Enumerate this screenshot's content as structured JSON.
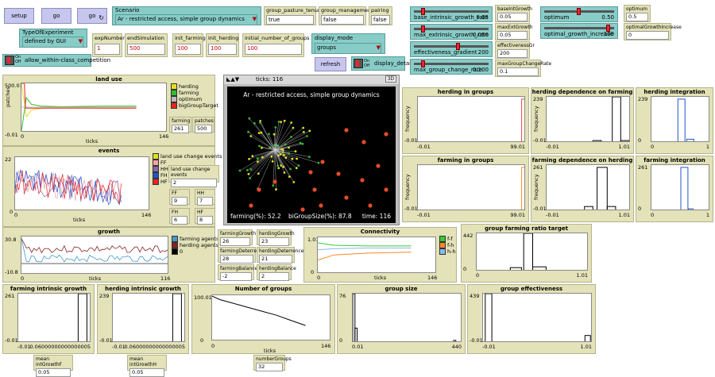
{
  "controls": {
    "setup_label": "setup",
    "go_label": "go",
    "go_forever_label": "go",
    "refresh_label": "refresh",
    "on_label": "On",
    "off_label": "Off"
  },
  "scenario": {
    "label": "Scenario",
    "value": "Ar - restricted access, simple group dynamics"
  },
  "group_pasture_tenure": {
    "label": "group_pasture_tenure",
    "value": "true"
  },
  "group_management": {
    "label": "group_management",
    "value": "false"
  },
  "pairing": {
    "label": "pairing",
    "value": "false"
  },
  "type_of_experiment": {
    "label": "TypeOfExperiment",
    "value": "defined by GUI"
  },
  "exp_number": {
    "label": "expNumber",
    "value": "1"
  },
  "end_simulation": {
    "label": "endSimulation",
    "value": "500"
  },
  "init_farming": {
    "label": "init_farming",
    "value": "100"
  },
  "init_herding": {
    "label": "init_herding",
    "value": "100"
  },
  "initial_number_of_groups": {
    "label": "initial_number_of_groups",
    "value": "100"
  },
  "display_mode": {
    "label": "display_mode",
    "value": "groups"
  },
  "display_details": {
    "label": "display_details"
  },
  "allow_within_class": {
    "label": "allow_within-class_competition"
  },
  "sliders": {
    "base_intrinsic": {
      "label": "base_intrinsic_growth_rate",
      "value": "0.05",
      "level": 0.1
    },
    "max_extrinsic": {
      "label": "max_extrinsic_growth_rate",
      "value": "0.050",
      "level": 0.1
    },
    "effectiveness": {
      "label": "effectiveness_gradient",
      "value": "200",
      "level": 0.6
    },
    "max_group_change": {
      "label": "max_group_change_rate",
      "value": "0.100",
      "level": 0.1
    },
    "optimum": {
      "label": "optimum",
      "value": "0.50",
      "level": 0.5
    },
    "optimal_growth": {
      "label": "optimal_growth_increase",
      "value": "100",
      "level": 0.95
    }
  },
  "monitors": {
    "base_int_growth": {
      "label": "baseIntGrowth",
      "value": "0.05"
    },
    "max_ext_growth": {
      "label": "maxExtGrowth",
      "value": "0.05"
    },
    "effectiveness_gr": {
      "label": "effectivenessGr",
      "value": "200"
    },
    "max_group_change_rate": {
      "label": "maxGroupChangeRate",
      "value": "0.1"
    },
    "optimum_m": {
      "label": "optimum",
      "value": "0.5"
    },
    "optimal_growth_increase": {
      "label": "optimalGrowthIncrease",
      "value": "0"
    },
    "farming": {
      "label": "farming",
      "value": "261"
    },
    "patches": {
      "label": "patches",
      "value": "500"
    },
    "land_use_change_events": {
      "label": "land use change events",
      "value": "2"
    },
    "ff": {
      "label": "FF",
      "value": "9"
    },
    "hh": {
      "label": "HH",
      "value": "7"
    },
    "fh": {
      "label": "FH",
      "value": "6"
    },
    "hf": {
      "label": "HF",
      "value": "8"
    },
    "farming_growth": {
      "label": "farmingGrowth",
      "value": "26"
    },
    "herding_growth": {
      "label": "herdingGrowth",
      "value": "23"
    },
    "farming_deterrence": {
      "label": "farmingDeterrence",
      "value": "28"
    },
    "herding_deterrence": {
      "label": "herdingDeterrence",
      "value": "21"
    },
    "farming_balance": {
      "label": "farmingBalance",
      "value": "-2"
    },
    "herding_balance": {
      "label": "herdingBalance",
      "value": "2"
    },
    "mean_int_growth_f": {
      "label": "mean intGrowthF",
      "value": "0.05"
    },
    "mean_int_growth_h": {
      "label": "mean intGrowthH",
      "value": "0.05"
    },
    "number_groups": {
      "label": "numberGroups",
      "value": "32"
    }
  },
  "view": {
    "ticks_label": "ticks: 116",
    "three_d": "3D",
    "title": "Ar - restricted access, simple group dynamics",
    "farming_pct": "farming(%): 52.2",
    "big_group_size": "biGroupSize(%): 87.8",
    "time": "time: 116"
  },
  "colors": {
    "herding": "#e0e020",
    "farming": "#33bb33",
    "optimum": "#bbbbbb",
    "big_group_target": "#ee2222",
    "ff": "#f0a0a8",
    "hh": "#8866aa",
    "fh": "#2255cc",
    "hf": "#ee2222",
    "farming_agents": "#4499cc",
    "herding_agents": "#882222",
    "zero": "#000000",
    "f_f": "#33cc33",
    "f_h": "#ff8822",
    "h_h": "#88bbee"
  },
  "chart_data": [
    {
      "name": "land use",
      "type": "line",
      "title": "land use",
      "ylabel": "patches",
      "xlabel": "ticks",
      "ylim": [
        -0.01,
        500.01
      ],
      "xlim": [
        0,
        146
      ],
      "y_top_label": "500.01",
      "y_bottom_label": "-0.01",
      "x_left_label": "0",
      "x_right_label": "146",
      "legend": [
        "herding",
        "farming",
        "optimum",
        "bigGroupTarget"
      ],
      "series": [
        {
          "name": "herding",
          "x": [
            0,
            5,
            10,
            20,
            40,
            80,
            116
          ],
          "y": [
            500,
            150,
            220,
            240,
            245,
            240,
            239
          ]
        },
        {
          "name": "farming",
          "x": [
            0,
            5,
            10,
            20,
            40,
            80,
            116
          ],
          "y": [
            0,
            350,
            280,
            260,
            255,
            260,
            261
          ]
        },
        {
          "name": "optimum",
          "x": [
            0,
            116
          ],
          "y": [
            250,
            250
          ]
        },
        {
          "name": "bigGroupTarget",
          "x": [
            0,
            3,
            4,
            116
          ],
          "y": [
            500,
            500,
            240,
            240
          ]
        }
      ]
    },
    {
      "name": "events",
      "type": "line",
      "title": "events",
      "xlabel": "ticks",
      "ylim": [
        0,
        22
      ],
      "xlim": [
        0,
        146
      ],
      "y_top_label": "22",
      "y_bottom_label": "0",
      "x_left_label": "0",
      "x_right_label": "146",
      "legend": [
        "land use change events",
        "FF",
        "HH",
        "FH",
        "HF"
      ]
    },
    {
      "name": "growth",
      "type": "line",
      "title": "growth",
      "xlabel": "ticks",
      "ylim": [
        -10.8,
        30.8
      ],
      "xlim": [
        0,
        116
      ],
      "y_top_label": "30.8",
      "y_bottom_label": "-10.8",
      "x_left_label": "0",
      "x_right_label": "116",
      "legend": [
        "farming agents",
        "herding agents",
        "0"
      ]
    },
    {
      "name": "Connectivity",
      "type": "line",
      "title": "Connectivity",
      "xlabel": "ticks",
      "ylim": [
        0,
        1.01
      ],
      "xlim": [
        0,
        146
      ],
      "y_top_label": "1.01",
      "y_bottom_label": "0",
      "x_left_label": "0",
      "x_right_label": "146",
      "legend": [
        "f-f",
        "f-h",
        "h-h"
      ],
      "series": [
        {
          "name": "f-f",
          "x": [
            0,
            20,
            60,
            116
          ],
          "y": [
            0.85,
            0.78,
            0.76,
            0.76
          ]
        },
        {
          "name": "f-h",
          "x": [
            0,
            20,
            60,
            116
          ],
          "y": [
            0.35,
            0.5,
            0.55,
            0.58
          ]
        },
        {
          "name": "h-h",
          "x": [
            0,
            20,
            60,
            116
          ],
          "y": [
            0.65,
            0.68,
            0.7,
            0.7
          ]
        }
      ]
    },
    {
      "name": "herding in groups",
      "type": "bar",
      "title": "herding in groups",
      "ylabel": "frequency",
      "xlim": [
        -0.01,
        99.01
      ],
      "y_bottom_label": "-0.01",
      "x_left_label": "-0.01",
      "x_right_label": "99.01"
    },
    {
      "name": "herding dependence on farming",
      "type": "bar",
      "title": "herding dependence on farming",
      "ylabel": "frequency",
      "ylim": [
        -0.01,
        239
      ],
      "xlim": [
        -0.01,
        1.01
      ],
      "y_top_label": "239",
      "y_bottom_label": "-0.01",
      "x_left_label": "-0.01",
      "x_right_label": "1.01"
    },
    {
      "name": "herding integration",
      "type": "bar",
      "title": "herding integration",
      "ylim": [
        0,
        239
      ],
      "xlim": [
        0,
        1
      ],
      "y_top_label": "239",
      "y_bottom_label": "0",
      "x_left_label": "0",
      "x_right_label": "1"
    },
    {
      "name": "farming in groups",
      "type": "bar",
      "title": "farming in groups",
      "ylabel": "frequency",
      "xlim": [
        -0.01,
        99.01
      ],
      "y_bottom_label": "-0.01",
      "x_left_label": "-0.01",
      "x_right_label": "99.01"
    },
    {
      "name": "farming dependence on herding",
      "type": "bar",
      "title": "farming dependence on herding",
      "ylabel": "frequency",
      "ylim": [
        -0.01,
        261
      ],
      "xlim": [
        -0.01,
        1.01
      ],
      "y_top_label": "261",
      "y_bottom_label": "-0.01",
      "x_left_label": "-0.01",
      "x_right_label": "1.01"
    },
    {
      "name": "farming integration",
      "type": "bar",
      "title": "farming integration",
      "ylim": [
        0,
        261
      ],
      "xlim": [
        0,
        1
      ],
      "y_top_label": "261",
      "y_bottom_label": "0",
      "x_left_label": "0",
      "x_right_label": "1"
    },
    {
      "name": "group farming ratio target",
      "type": "bar",
      "title": "group farming ratio target",
      "ylim": [
        0,
        442
      ],
      "xlim": [
        0,
        1.01
      ],
      "y_top_label": "442",
      "y_bottom_label": "0",
      "x_left_label": "0",
      "x_right_label": "1.01"
    },
    {
      "name": "farming intrinsic growth rate",
      "type": "bar",
      "title": "farming intrinsic growth ra...",
      "ylim": [
        -0.01,
        261
      ],
      "y_top_label": "261",
      "y_bottom_label": "-0.01",
      "x_left_label": "-0.01",
      "x_right_label": "0.06000000000000005"
    },
    {
      "name": "herding intrinsic growth rate",
      "type": "bar",
      "title": "herding intrinsic growth rate",
      "ylim": [
        -0.01,
        239
      ],
      "y_top_label": "239",
      "y_bottom_label": "-0.01",
      "x_left_label": "-0.01",
      "x_right_label": "0.06000000000000005"
    },
    {
      "name": "Number of groups",
      "type": "line",
      "title": "Number of groups",
      "xlabel": "ticks",
      "ylim": [
        0,
        100.01
      ],
      "xlim": [
        0,
        146
      ],
      "y_top_label": "100.01",
      "y_bottom_label": "0",
      "x_left_label": "0",
      "x_right_label": "146",
      "series": [
        {
          "name": "groups",
          "x": [
            0,
            10,
            20,
            40,
            60,
            80,
            100,
            116
          ],
          "y": [
            98,
            90,
            85,
            75,
            65,
            55,
            42,
            32
          ]
        }
      ]
    },
    {
      "name": "group size",
      "type": "bar",
      "title": "group size",
      "ylim": [
        0,
        76
      ],
      "xlim": [
        0.01,
        440
      ],
      "y_top_label": "76",
      "y_bottom_label": "0",
      "x_left_label": "0.01",
      "x_right_label": "440"
    },
    {
      "name": "group effectiveness",
      "type": "bar",
      "title": "group effectiveness",
      "ylim": [
        -0.01,
        439
      ],
      "xlim": [
        -0.01,
        1.01
      ],
      "y_top_label": "439",
      "y_bottom_label": "-0.01",
      "x_left_label": "-0.01",
      "x_right_label": "1.01"
    }
  ]
}
